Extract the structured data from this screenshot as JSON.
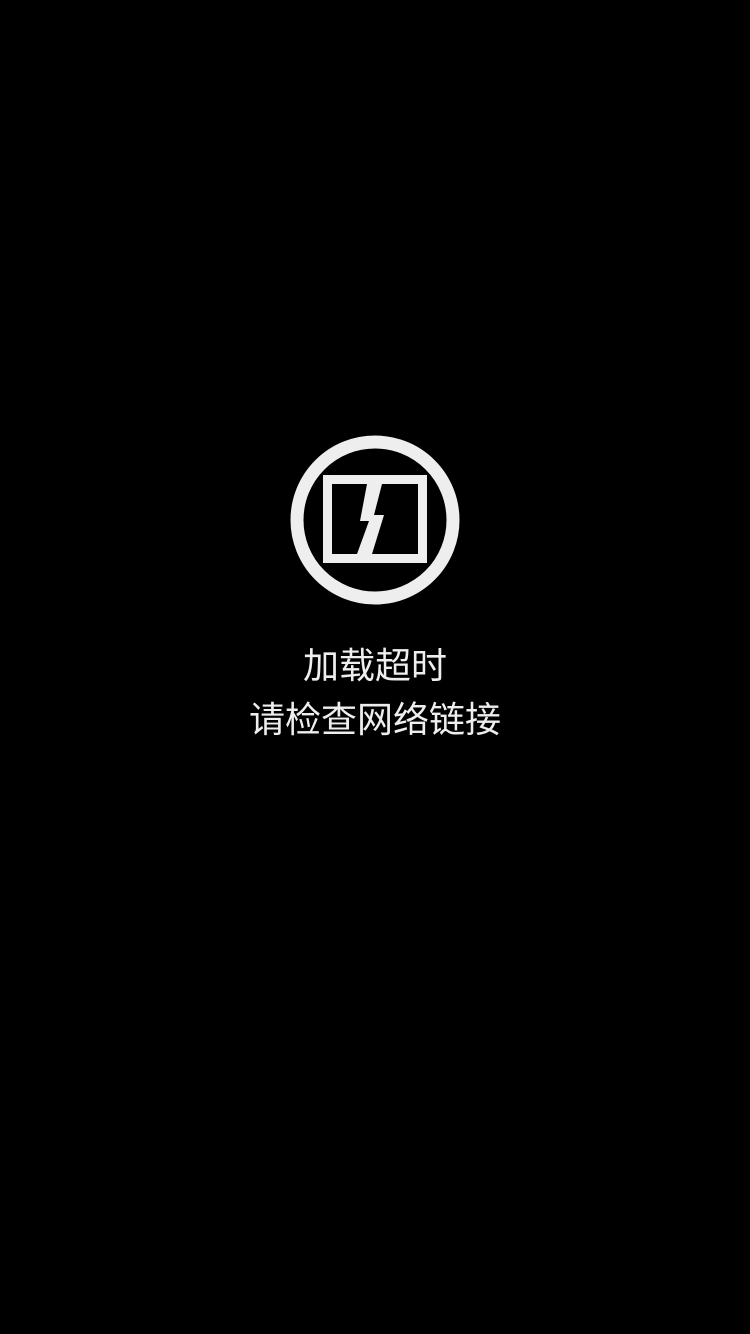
{
  "error": {
    "icon": "broken-screen-icon",
    "title": "加载超时",
    "hint": "请检查网络链接"
  },
  "colors": {
    "background": "#000000",
    "foreground": "#eeeeee"
  }
}
